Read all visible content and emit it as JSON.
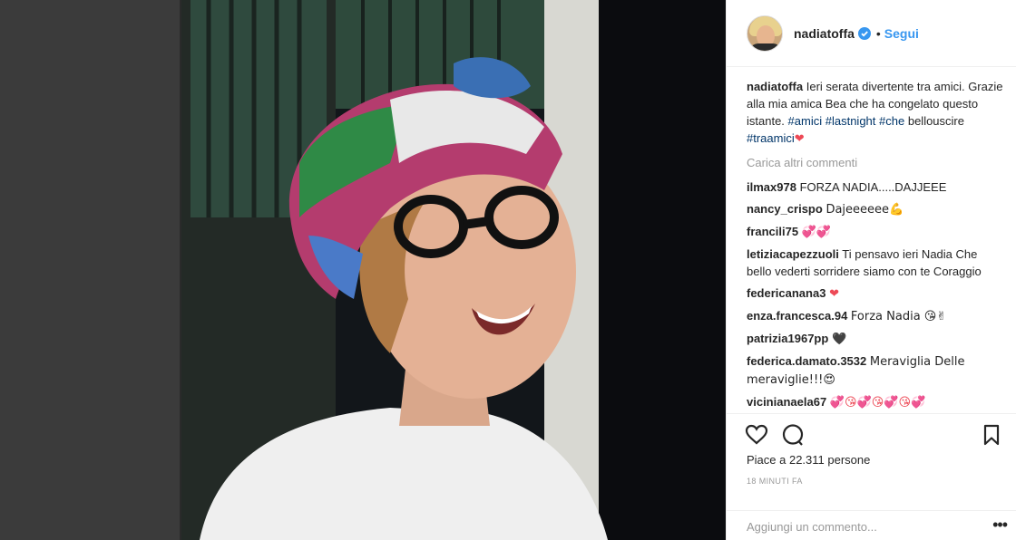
{
  "post": {
    "username": "nadiatoffa",
    "follow_label": "Segui",
    "dot": "•",
    "caption": {
      "user": "nadiatoffa",
      "text_1": " Ieri serata divertente tra amici. Grazie alla mia amica Bea che ha congelato questo istante. ",
      "tag_1": "#amici",
      "tag_2": "#lastnight",
      "tag_3": "#che",
      "text_2": "bellouscire ",
      "tag_4": "#traamici",
      "emoji": "❤"
    },
    "load_more": "Carica altri commenti",
    "comments": [
      {
        "user": "ilmax978",
        "text": "FORZA NADIA.....DAJJEEE"
      },
      {
        "user": "nancy_crispo",
        "text": "Dajeeeeee💪"
      },
      {
        "user": "francili75",
        "text": "💞💞"
      },
      {
        "user": "letiziacapezzuoli",
        "text": "Ti pensavo ieri Nadia Che bello vederti sorridere siamo con te Coraggio"
      },
      {
        "user": "federicanana3",
        "text": "❤"
      },
      {
        "user": "enza.francesca.94",
        "text": "Forza Nadia 😘✌"
      },
      {
        "user": "patrizia1967pp",
        "text": "🖤"
      },
      {
        "user": "federica.damato.3532",
        "text": "Meraviglia Delle meraviglie!!!😍"
      },
      {
        "user": "vicinianaela67",
        "text": "💞😘💞😘💞😘💞"
      }
    ],
    "likes": "Piace a 22.311 persone",
    "time_ago": "18 MINUTI FA",
    "add_comment_placeholder": "Aggiungi un commento...",
    "more_label": "•••"
  },
  "colors": {
    "link_blue": "#3897f0",
    "hashtag": "#003569",
    "muted": "#999999",
    "text": "#262626",
    "heart": "#ed4956"
  },
  "icons": [
    "verified-badge-icon",
    "heart-icon",
    "comment-icon",
    "bookmark-icon",
    "more-options-icon"
  ]
}
